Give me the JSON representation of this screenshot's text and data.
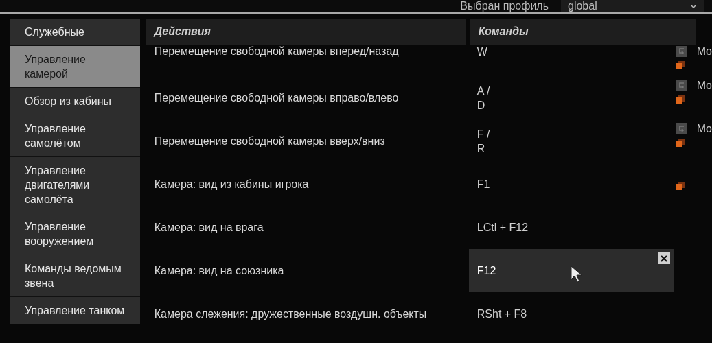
{
  "profile": {
    "label": "Выбран профиль",
    "value": "global"
  },
  "sidebar": {
    "items": [
      {
        "label": "Служебные",
        "selected": false
      },
      {
        "label": "Управление камерой",
        "selected": true
      },
      {
        "label": "Обзор из кабины",
        "selected": false
      },
      {
        "label": "Управление самолётом",
        "selected": false
      },
      {
        "label": "Управление двигателями самолёта",
        "selected": false
      },
      {
        "label": "Управление вооружением",
        "selected": false
      },
      {
        "label": "Команды ведомым звена",
        "selected": false
      },
      {
        "label": "Управление танком",
        "selected": false
      }
    ]
  },
  "table": {
    "columns": [
      "Действия",
      "Команды"
    ],
    "rows": [
      {
        "action": "Перемещение свободной камеры вперед/назад",
        "command": [
          "W"
        ],
        "selected": false,
        "extra": "Mo",
        "marker": true
      },
      {
        "action": "Перемещение свободной камеры вправо/влево",
        "command": [
          "A /",
          "D"
        ],
        "selected": false,
        "extra": "Mo",
        "marker": true
      },
      {
        "action": "Перемещение свободной камеры вверх/вниз",
        "command": [
          "F /",
          "R"
        ],
        "selected": false,
        "extra": "Mo",
        "marker": true
      },
      {
        "action": "Камера: вид из кабины игрока",
        "command": [
          "F1"
        ],
        "selected": false,
        "marker": true
      },
      {
        "action": "Камера: вид на врага",
        "command": [
          "LCtl + F12"
        ],
        "selected": false,
        "marker": false
      },
      {
        "action": "Камера: вид на союзника",
        "command": [
          "F12"
        ],
        "selected": true,
        "marker": false
      },
      {
        "action": "Камера слежения: дружественные воздушн. объекты",
        "command": [
          "RSht + F8"
        ],
        "selected": false,
        "marker": false
      }
    ]
  }
}
